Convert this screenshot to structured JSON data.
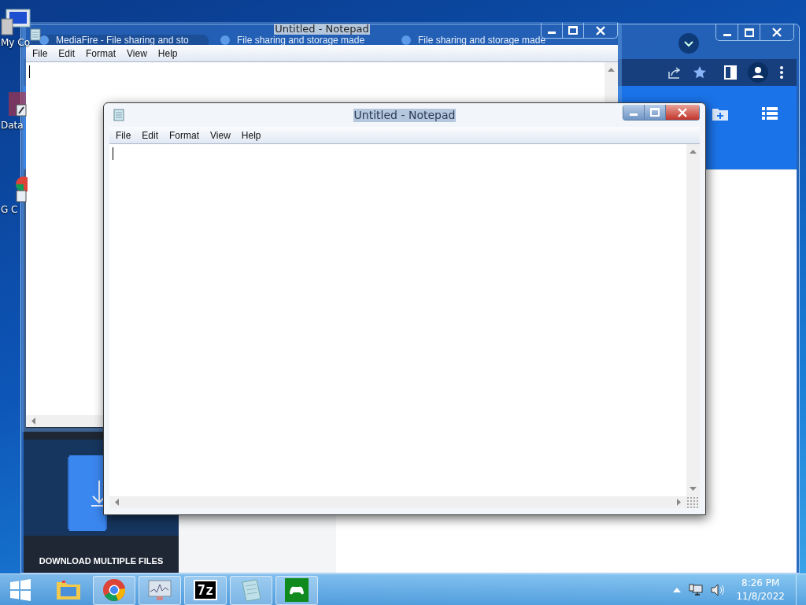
{
  "desktop_icons": [
    {
      "kind": "computer",
      "label": "My Co"
    },
    {
      "kind": "shortcut",
      "label": "Data"
    },
    {
      "kind": "chrome",
      "label": "G C"
    }
  ],
  "browser": {
    "tabs": [
      {
        "title": "MediaFire - File sharing and sto",
        "selected": true
      },
      {
        "title": "File sharing and storage made",
        "selected": false
      },
      {
        "title": "File sharing and storage made",
        "selected": false
      }
    ],
    "promo": {
      "text": "DOWNLOAD MULTIPLE FILES"
    }
  },
  "notepads": [
    {
      "title": "Untitled - Notepad",
      "active": false,
      "menu": [
        "File",
        "Edit",
        "Format",
        "View",
        "Help"
      ]
    },
    {
      "title": "Untitled - Notepad",
      "active": true,
      "menu": [
        "File",
        "Edit",
        "Format",
        "View",
        "Help"
      ]
    }
  ],
  "taskbar": {
    "items": [
      {
        "kind": "start",
        "running": false
      },
      {
        "kind": "explorer",
        "running": false
      },
      {
        "kind": "chrome",
        "running": true
      },
      {
        "kind": "monitor",
        "running": true
      },
      {
        "kind": "sevenzip",
        "label": "7z",
        "running": true
      },
      {
        "kind": "notepad",
        "running": true
      },
      {
        "kind": "game",
        "running": true
      }
    ],
    "time": "8:26 PM",
    "date": "11/8/2022"
  }
}
